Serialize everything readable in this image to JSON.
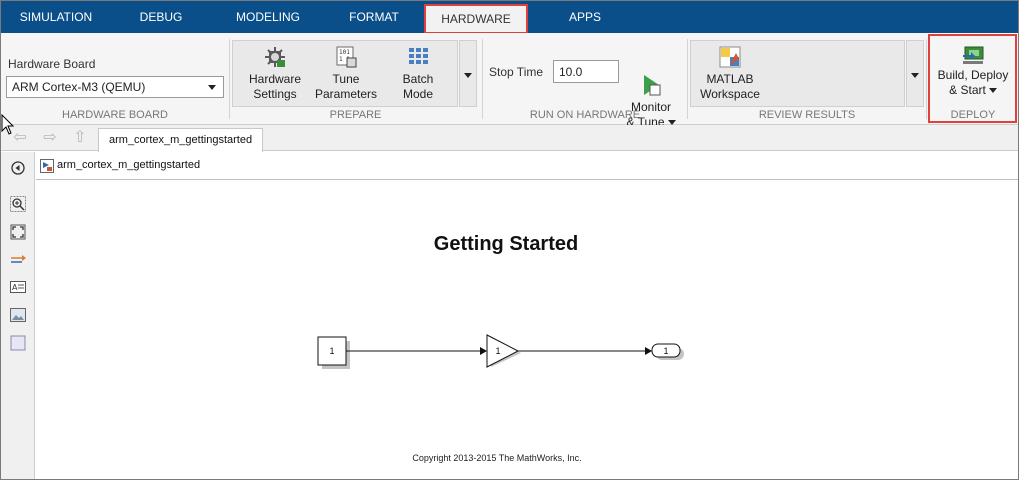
{
  "tabs": [
    {
      "label": "SIMULATION"
    },
    {
      "label": "DEBUG"
    },
    {
      "label": "MODELING"
    },
    {
      "label": "FORMAT"
    },
    {
      "label": "HARDWARE"
    },
    {
      "label": "APPS"
    }
  ],
  "active_tab": "HARDWARE",
  "ribbon": {
    "hardware_board": {
      "field_label": "Hardware Board",
      "selected": "ARM Cortex-M3 (QEMU)",
      "section_title": "HARDWARE BOARD"
    },
    "prepare": {
      "section_title": "PREPARE",
      "hardware_settings": {
        "line1": "Hardware",
        "line2": "Settings",
        "icon": "gear-chip-icon"
      },
      "tune_parameters": {
        "line1": "Tune",
        "line2": "Parameters",
        "icon": "tune-parameters-icon"
      },
      "batch_mode": {
        "line1": "Batch",
        "line2": "Mode",
        "icon": "grid-icon"
      }
    },
    "run_on_hardware": {
      "section_title": "RUN ON HARDWARE",
      "stop_time_label": "Stop Time",
      "stop_time_value": "10.0",
      "monitor_tune": {
        "line1": "Monitor",
        "line2": "& Tune",
        "icon": "play-monitor-icon"
      }
    },
    "review_results": {
      "section_title": "REVIEW RESULTS",
      "matlab_workspace": {
        "line1": "MATLAB",
        "line2": "Workspace",
        "icon": "workspace-icon"
      }
    },
    "deploy": {
      "section_title": "DEPLOY",
      "build_deploy_start": {
        "line1": "Build, Deploy",
        "line2": "& Start",
        "icon": "build-deploy-icon"
      }
    }
  },
  "model_tab": "arm_cortex_m_gettingstarted",
  "breadcrumb": "arm_cortex_m_gettingstarted",
  "left_toolbar": [
    "hide-show-browser-icon",
    "zoom-icon",
    "fit-to-view-icon",
    "signal-line-icon",
    "annotation-icon",
    "image-icon",
    "area-icon"
  ],
  "canvas": {
    "title": "Getting Started",
    "inport_label": "1",
    "gain_label": "1",
    "outport_label": "1",
    "copyright": "Copyright 2013-2015 The MathWorks, Inc."
  },
  "colors": {
    "tab_bar": "#0b4f8a",
    "highlight": "#e0403a",
    "ribbon_bg": "#f5f5f5"
  }
}
